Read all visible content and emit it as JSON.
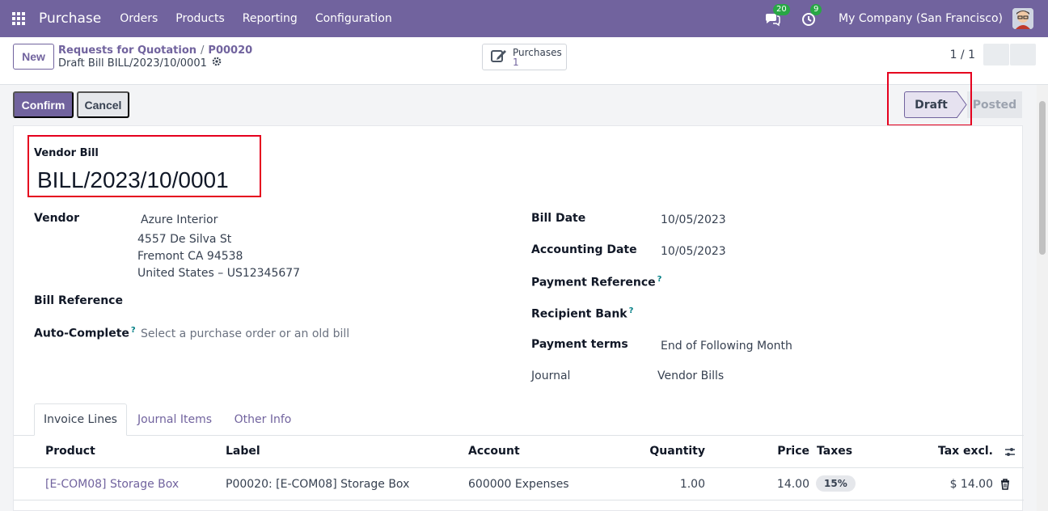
{
  "navbar": {
    "app_name": "Purchase",
    "menu": [
      "Orders",
      "Products",
      "Reporting",
      "Configuration"
    ],
    "messages_count": "20",
    "activities_count": "9",
    "company": "My Company (San Francisco)"
  },
  "control": {
    "new_label": "New",
    "breadcrumb": [
      "Requests for Quotation",
      "P00020"
    ],
    "record_title": "Draft Bill BILL/2023/10/0001",
    "smart_button": {
      "label": "Purchases",
      "value": "1"
    },
    "pager": "1 / 1"
  },
  "actions": {
    "confirm_label": "Confirm",
    "cancel_label": "Cancel"
  },
  "status": {
    "stages": [
      "Draft",
      "Posted"
    ],
    "current": "Draft"
  },
  "form": {
    "move_type": "Vendor Bill",
    "name": "BILL/2023/10/0001",
    "vendor_label": "Vendor",
    "vendor_name": "Azure Interior",
    "vendor_address": [
      "4557 De Silva St",
      "Fremont CA 94538",
      "United States – US12345677"
    ],
    "bill_reference_label": "Bill Reference",
    "auto_complete_label": "Auto-Complete",
    "auto_complete_placeholder": "Select a purchase order or an old bill",
    "bill_date_label": "Bill Date",
    "bill_date": "10/05/2023",
    "accounting_date_label": "Accounting Date",
    "accounting_date": "10/05/2023",
    "payment_reference_label": "Payment Reference",
    "recipient_bank_label": "Recipient Bank",
    "payment_terms_label": "Payment terms",
    "payment_terms": "End of Following Month",
    "journal_label": "Journal",
    "journal": "Vendor Bills",
    "help_mark": "?"
  },
  "tabs": [
    "Invoice Lines",
    "Journal Items",
    "Other Info"
  ],
  "lines": {
    "columns": [
      "Product",
      "Label",
      "Account",
      "Quantity",
      "Price",
      "Taxes",
      "Tax excl."
    ],
    "rows": [
      {
        "product": "[E-COM08] Storage Box",
        "label": "P00020: [E-COM08] Storage Box",
        "account": "600000 Expenses",
        "quantity": "1.00",
        "price": "14.00",
        "taxes": "15%",
        "subtotal": "$ 14.00"
      }
    ]
  },
  "colors": {
    "brand": "#71639e",
    "annotation": "#e5001e"
  }
}
